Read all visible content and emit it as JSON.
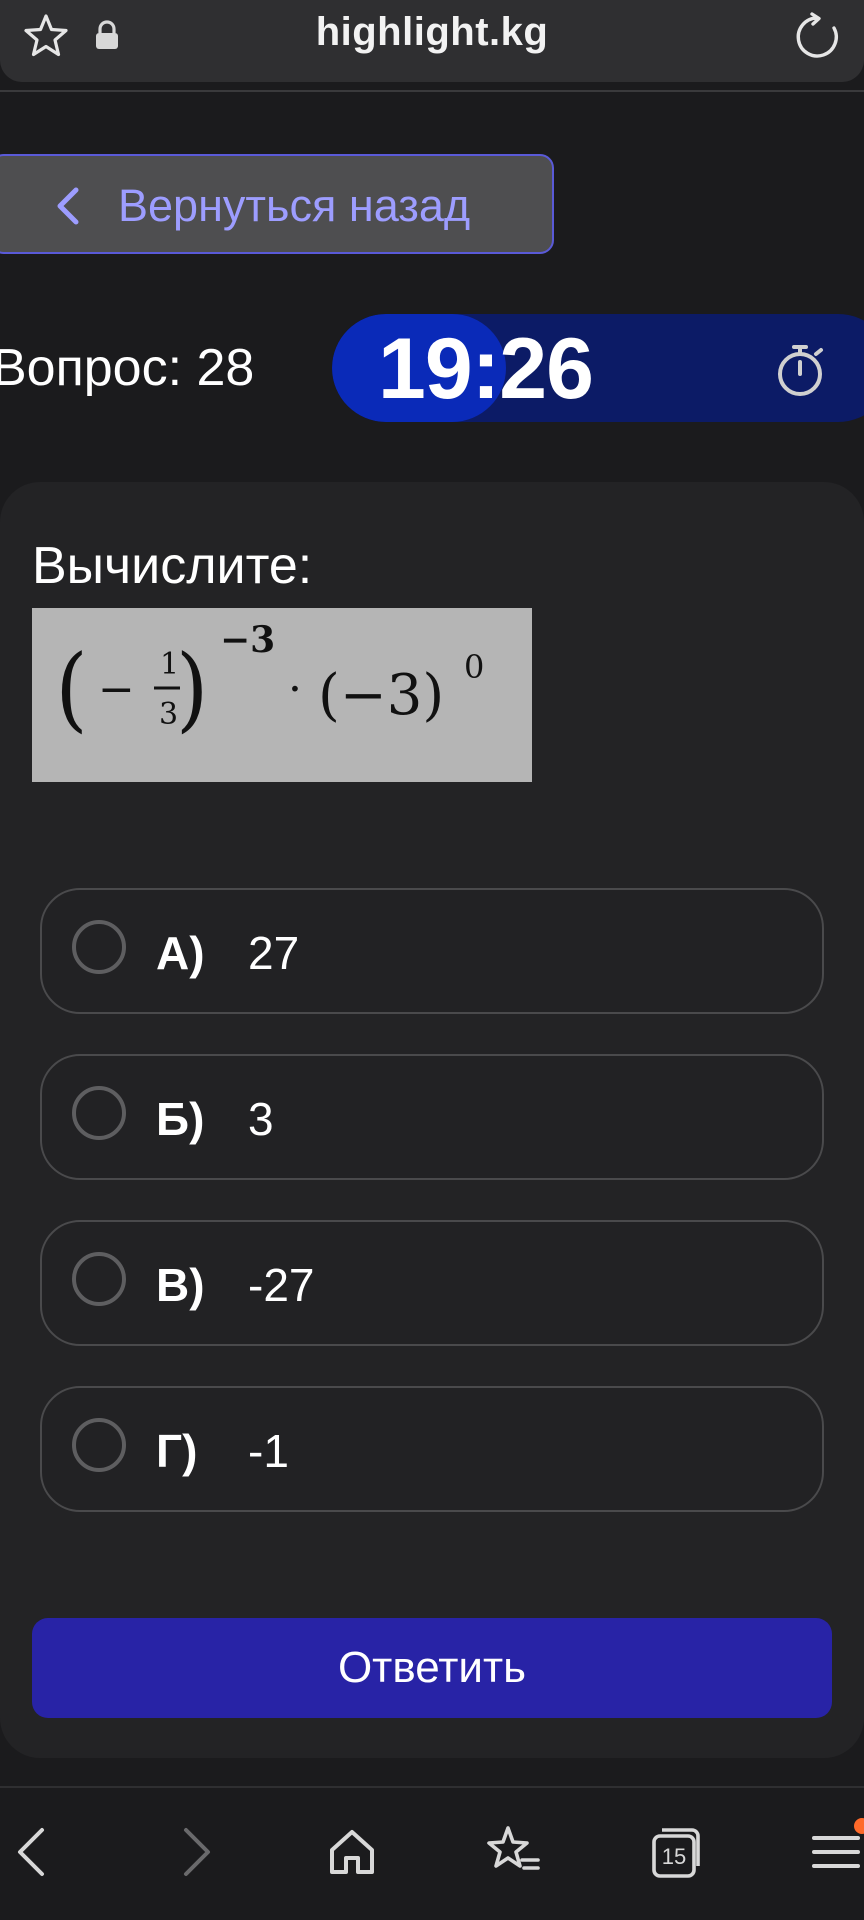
{
  "browser": {
    "url": "highlight.kg",
    "tabs_count": "15",
    "icons": [
      "star-icon",
      "lock-icon",
      "reload-icon"
    ]
  },
  "back_button": {
    "label": "Вернуться назад",
    "icon": "chevron-left-icon"
  },
  "quiz": {
    "question_label": "Вопрос: 28",
    "timer": "19:26",
    "timer_progress": 0.31,
    "prompt": "Вычислите:",
    "formula": {
      "base_sign": "−",
      "numerator": "1",
      "denominator": "3",
      "exponent1": "−3",
      "dot": "·",
      "second_base": "(−3)",
      "exponent2": "0"
    },
    "options": [
      {
        "letter": "А)",
        "value": "27"
      },
      {
        "letter": "Б)",
        "value": "3"
      },
      {
        "letter": "В)",
        "value": "-27"
      },
      {
        "letter": "Г)",
        "value": "-1"
      }
    ],
    "submit_label": "Ответить"
  },
  "colors": {
    "background": "#1b1b1d",
    "card": "#232325",
    "accent": "#2823a6",
    "back_text": "#9d9dff",
    "timer_bg": "#0c1b66",
    "timer_fill": "#0a2ab8"
  }
}
